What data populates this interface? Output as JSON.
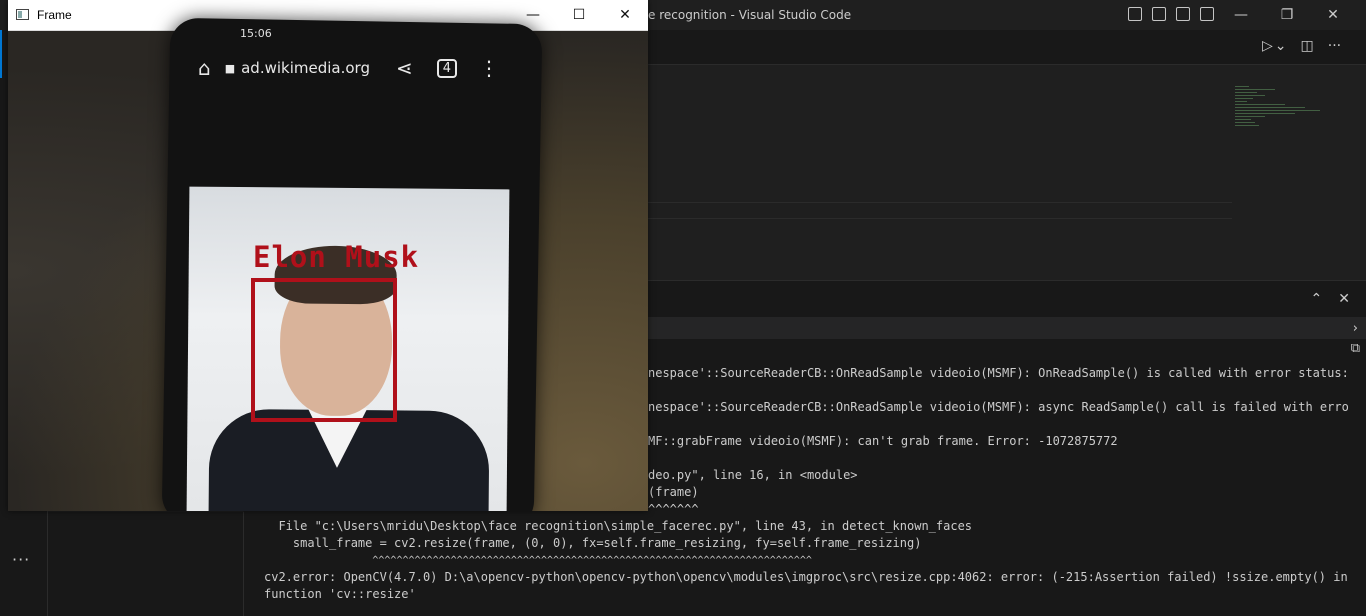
{
  "vscode": {
    "title": "face recognition - Visual Studio Code",
    "title_visible": "e recognition - Visual Studio Code",
    "window_controls": {
      "minimize": "—",
      "restore": "❐",
      "close": "✕"
    },
    "editor_actions": {
      "run": "▷",
      "run_dropdown": "⌄",
      "split": "◫",
      "more": "···"
    },
    "panel_actions": {
      "maximize": "⌃",
      "close": "✕"
    },
    "activity_more": "···",
    "terminal_lines": [
      "nespace'::SourceReaderCB::OnReadSample videoio(MSMF): OnReadSample() is called with error status:",
      "nespace'::SourceReaderCB::OnReadSample videoio(MSMF): async ReadSample() call is failed with erro",
      "MF::grabFrame videoio(MSMF): can't grab frame. Error: -1072875772",
      "deo.py\", line 16, in <module>",
      "(frame)",
      "^^^^^^^",
      "  File \"c:\\Users\\mridu\\Desktop\\face recognition\\simple_facerec.py\", line 43, in detect_known_faces",
      "    small_frame = cv2.resize(frame, (0, 0), fx=self.frame_resizing, fy=self.frame_resizing)",
      "                  ^^^^^^^^^^^^^^^^^^^^^^^^^^^^^^^^^^^^^^^^^^^^^^^^^^^^^^^^^^^^^^^^^^^^^^^^^",
      "cv2.error: OpenCV(4.7.0) D:\\a\\opencv-python\\opencv-python\\opencv\\modules\\imgproc\\src\\resize.cpp:4062: error: (-215:Assertion failed) !ssize.empty() in",
      "function 'cv::resize'"
    ]
  },
  "frame_window": {
    "title": "Frame",
    "controls": {
      "minimize": "—",
      "maximize": "☐",
      "close": "✕"
    },
    "phone": {
      "status_time": "15:06",
      "url": "ad.wikimedia.org",
      "tab_count": "4",
      "home_icon": "⌂",
      "lock_icon": "🔒",
      "share_icon": "⋖",
      "menu_icon": "⋮"
    },
    "detection": {
      "label": "Elon Musk",
      "box_color": "#b0101a"
    }
  }
}
